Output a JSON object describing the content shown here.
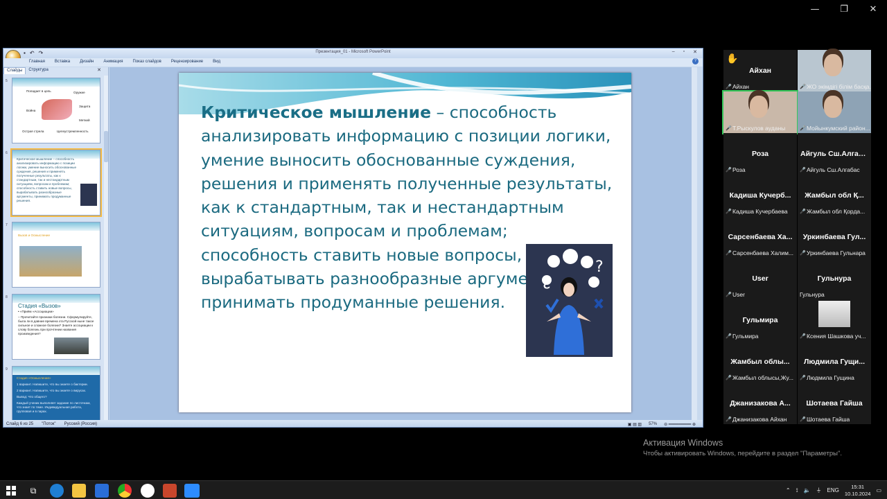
{
  "window_controls": {
    "minimize": "—",
    "restore": "❐",
    "close": "✕"
  },
  "ppt": {
    "title": "Презентация_01 - Microsoft PowerPoint",
    "ribbon_tabs": [
      "Главная",
      "Вставка",
      "Дизайн",
      "Анимация",
      "Показ слайдов",
      "Рецензирование",
      "Вид"
    ],
    "pane_tabs": [
      "Слайды",
      "Структура"
    ],
    "thumbs": [
      {
        "num": "5",
        "lines": [
          "Попадает в цель",
          "Оружие",
          "Война",
          "Защита",
          "Меткий",
          "Острая стрела",
          "Целеустремленность"
        ]
      },
      {
        "num": "6",
        "lines": [
          "Критическое мышление – способность анализировать информацию с позиции логики, умение выносить обоснованные суждения, решения и применять полученные результаты, как к стандартным, так и нестандартным ситуациям, вопросам и проблемам; способность ставить новые вопросы, вырабатывать разнообразные аргументы, принимать продуманные решения."
        ]
      },
      {
        "num": "7",
        "lines": [
          "Вызов и Осмысление"
        ]
      },
      {
        "num": "8",
        "lines": [
          "Стадия «Вызов»",
          "• «Приём «Ассоциации»",
          "– Прочитайте признаки болезни. Сформулируйте, была ли в давние времена эта Русской ныне такое сильное и сложное болезни? Знаете ассоциации к слову болезнь при прочтении названия произведения?"
        ]
      },
      {
        "num": "9",
        "lines": [
          "Стадия «Осмысление»",
          "1 вариант. Напишите, что вы знаете о бактерии.",
          "2 вариант. Напишите, что вы знаете о вирусах.",
          "Вывод: Что общего?",
          "Каждый ученик выполняет задание по листочкам, что знает по теме. Индивидуальная работа, групповая и в парах."
        ]
      }
    ],
    "slide": {
      "title_bold": "Критическое мышление",
      "title_rest": " – способность анализировать информацию с позиции логики, умение выносить обоснованные суждения, решения и применять полученные результаты, как к стандартным, так и нестандартным ситуациям, вопросам и проблемам; способность ставить новые вопросы, вырабатывать разнообразные аргументы, принимать продуманные решения."
    },
    "status": {
      "slide": "Слайд 6 из 25",
      "theme": "\"Поток\"",
      "lang": "Русский (Россия)",
      "zoom": "57%"
    }
  },
  "gallery": [
    {
      "name": "Айхан",
      "label": "Айхан",
      "hand": "✋"
    },
    {
      "name": "",
      "label": "ЖО экімдігі білім басқа...",
      "video": true
    },
    {
      "name": "",
      "label": "Т.Рыскулов ауданы",
      "video": true,
      "active": true
    },
    {
      "name": "",
      "label": "Мойынкумский район...",
      "video": true
    },
    {
      "name": "Роза",
      "label": "Роза"
    },
    {
      "name": "Айгуль Сш.Алгаба...",
      "label": "Айгуль Сш.Алгабас"
    },
    {
      "name": "Кадиша Кучерб...",
      "label": "Кадиша Кучербаева"
    },
    {
      "name": "Жамбыл обл Қ...",
      "label": "Жамбыл обл Қорда..."
    },
    {
      "name": "Сарсенбаева Ха...",
      "label": "Сарсенбаева Халим..."
    },
    {
      "name": "Уркинбаева Гул...",
      "label": "Уркинбаева Гульнара"
    },
    {
      "name": "User",
      "label": "User"
    },
    {
      "name": "Гульнура",
      "label": "Гульнура",
      "nomic": true
    },
    {
      "name": "Гульмира",
      "label": "Гульмира"
    },
    {
      "name": "",
      "label": "Ксения Шашкова уч...",
      "photo": true
    },
    {
      "name": "Жамбыл облы...",
      "label": "Жамбыл облысы,Жу..."
    },
    {
      "name": "Людмила Гущи...",
      "label": "Людмила Гущина"
    },
    {
      "name": "Джанизакова А...",
      "label": "Джанизакова Айхан"
    },
    {
      "name": "Шотаева Гайша",
      "label": "Шотаева Гайша"
    }
  ],
  "activation": {
    "title": "Активация Windows",
    "text": "Чтобы активировать Windows, перейдите в раздел \"Параметры\"."
  },
  "taskbar": {
    "lang": "ENG",
    "time": "15:31",
    "date": "10.10.2024"
  }
}
